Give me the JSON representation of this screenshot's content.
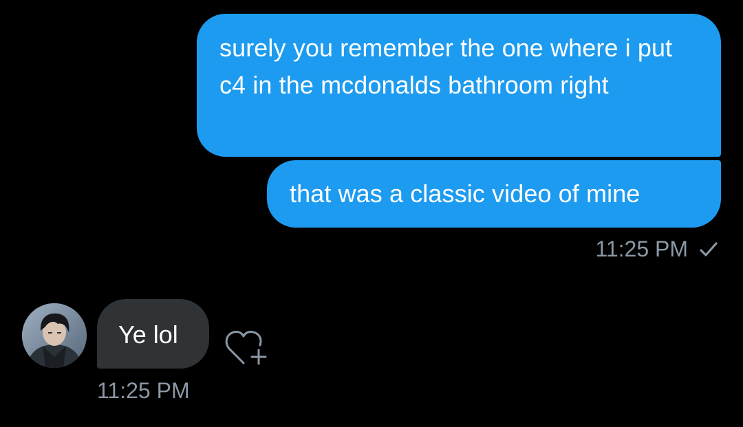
{
  "conversation": {
    "outgoing": [
      {
        "text": "surely you remember the one where i put c4 in the mcdonalds bathroom right"
      },
      {
        "text": "that was a classic video of mine"
      }
    ],
    "outgoing_time": "11:25 PM",
    "outgoing_status_icon": "check-icon",
    "incoming": [
      {
        "text": "Ye lol"
      }
    ],
    "incoming_time": "11:25 PM",
    "reaction_icon": "heart-add-icon"
  },
  "colors": {
    "background": "#000000",
    "outgoing_bubble": "#1d9bf0",
    "incoming_bubble": "#2f3336",
    "timestamp": "#8b98a5"
  }
}
